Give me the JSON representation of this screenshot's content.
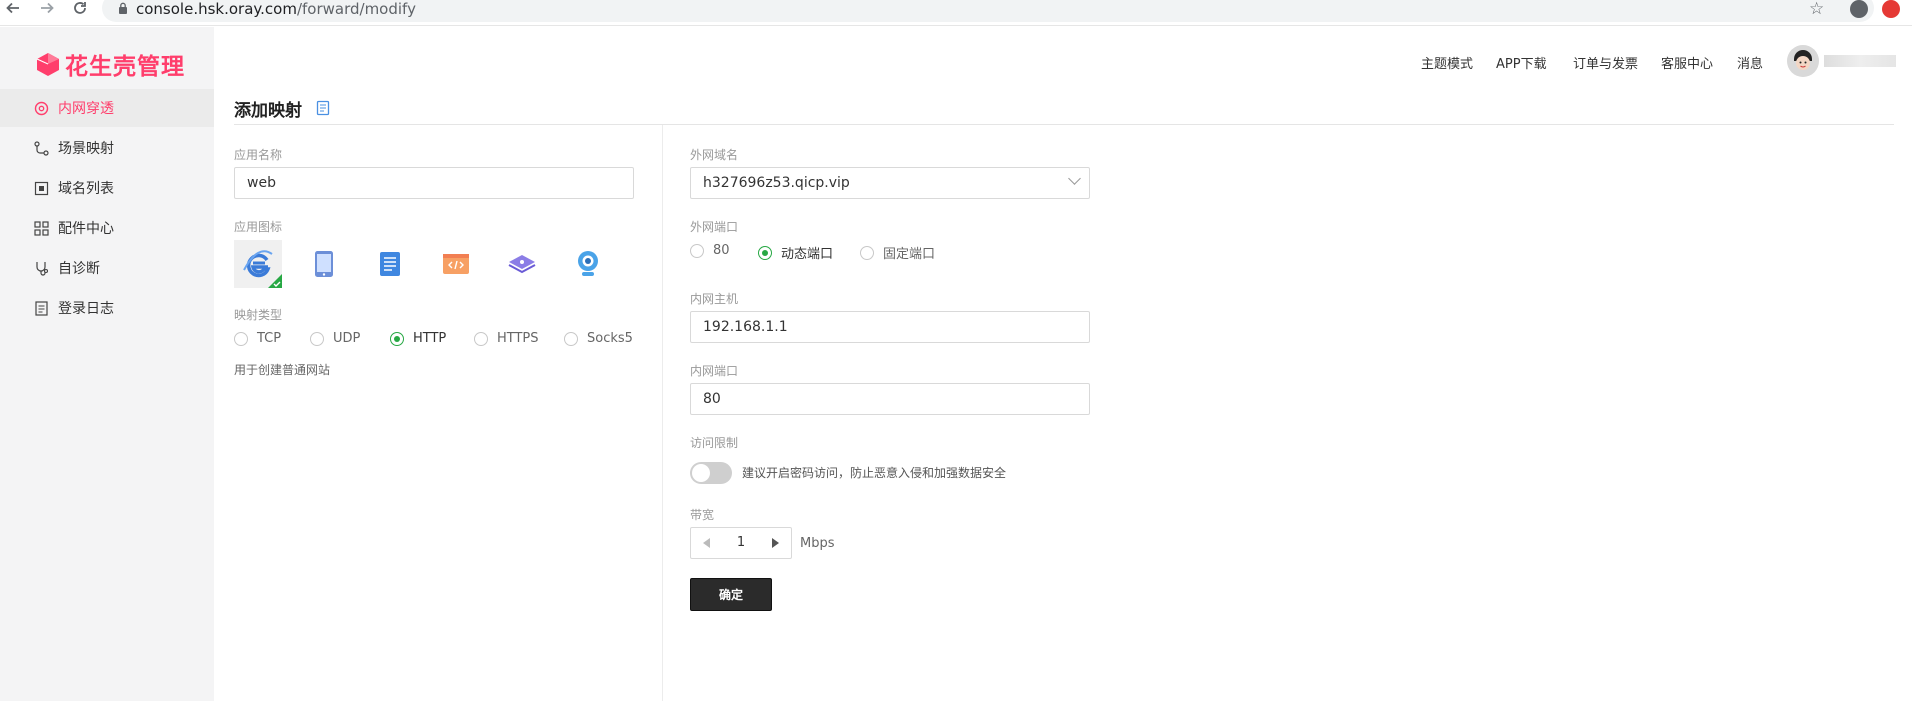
{
  "browser": {
    "url_host": "console.hsk.oray.com",
    "url_path": "/forward/modify",
    "back_icon": "arrow-left-icon",
    "forward_icon": "arrow-right-icon",
    "reload_icon": "reload-icon"
  },
  "sidebar": {
    "brand": "花生壳管理",
    "items": [
      {
        "label": "内网穿透",
        "icon": "network-icon",
        "active": true
      },
      {
        "label": "场景映射",
        "icon": "branch-icon",
        "active": false
      },
      {
        "label": "域名列表",
        "icon": "domain-icon",
        "active": false
      },
      {
        "label": "配件中心",
        "icon": "grid-icon",
        "active": false
      },
      {
        "label": "自诊断",
        "icon": "diagnose-icon",
        "active": false
      },
      {
        "label": "登录日志",
        "icon": "log-icon",
        "active": false
      }
    ]
  },
  "header": {
    "nav": [
      "主题模式",
      "APP下载",
      "订单与发票",
      "客服中心",
      "消息"
    ]
  },
  "page": {
    "title": "添加映射"
  },
  "form": {
    "app_name_label": "应用名称",
    "app_name_value": "web",
    "app_icon_label": "应用图标",
    "app_icons": [
      "ie-icon",
      "tablet-icon",
      "document-icon",
      "code-icon",
      "layers-icon",
      "webcam-icon"
    ],
    "selected_icon": "ie-icon",
    "mapping_type_label": "映射类型",
    "mapping_types": [
      "TCP",
      "UDP",
      "HTTP",
      "HTTPS",
      "Socks5"
    ],
    "mapping_type_selected": "HTTP",
    "mapping_hint": "用于创建普通网站",
    "domain_label": "外网域名",
    "domain_value": "h327696z53.qicp.vip",
    "ext_port_label": "外网端口",
    "ext_port_options": [
      "80",
      "动态端口",
      "固定端口"
    ],
    "ext_port_selected": "动态端口",
    "host_label": "内网主机",
    "host_value": "192.168.1.1",
    "int_port_label": "内网端口",
    "int_port_value": "80",
    "access_label": "访问限制",
    "access_hint": "建议开启密码访问，防止恶意入侵和加强数据安全",
    "access_enabled": false,
    "bandwidth_label": "带宽",
    "bandwidth_value": "1",
    "bandwidth_unit": "Mbps",
    "submit_label": "确定"
  },
  "colors": {
    "brand": "#ff3e6c",
    "radio_on": "#27a844",
    "submit_bg": "#2b2b2b"
  }
}
